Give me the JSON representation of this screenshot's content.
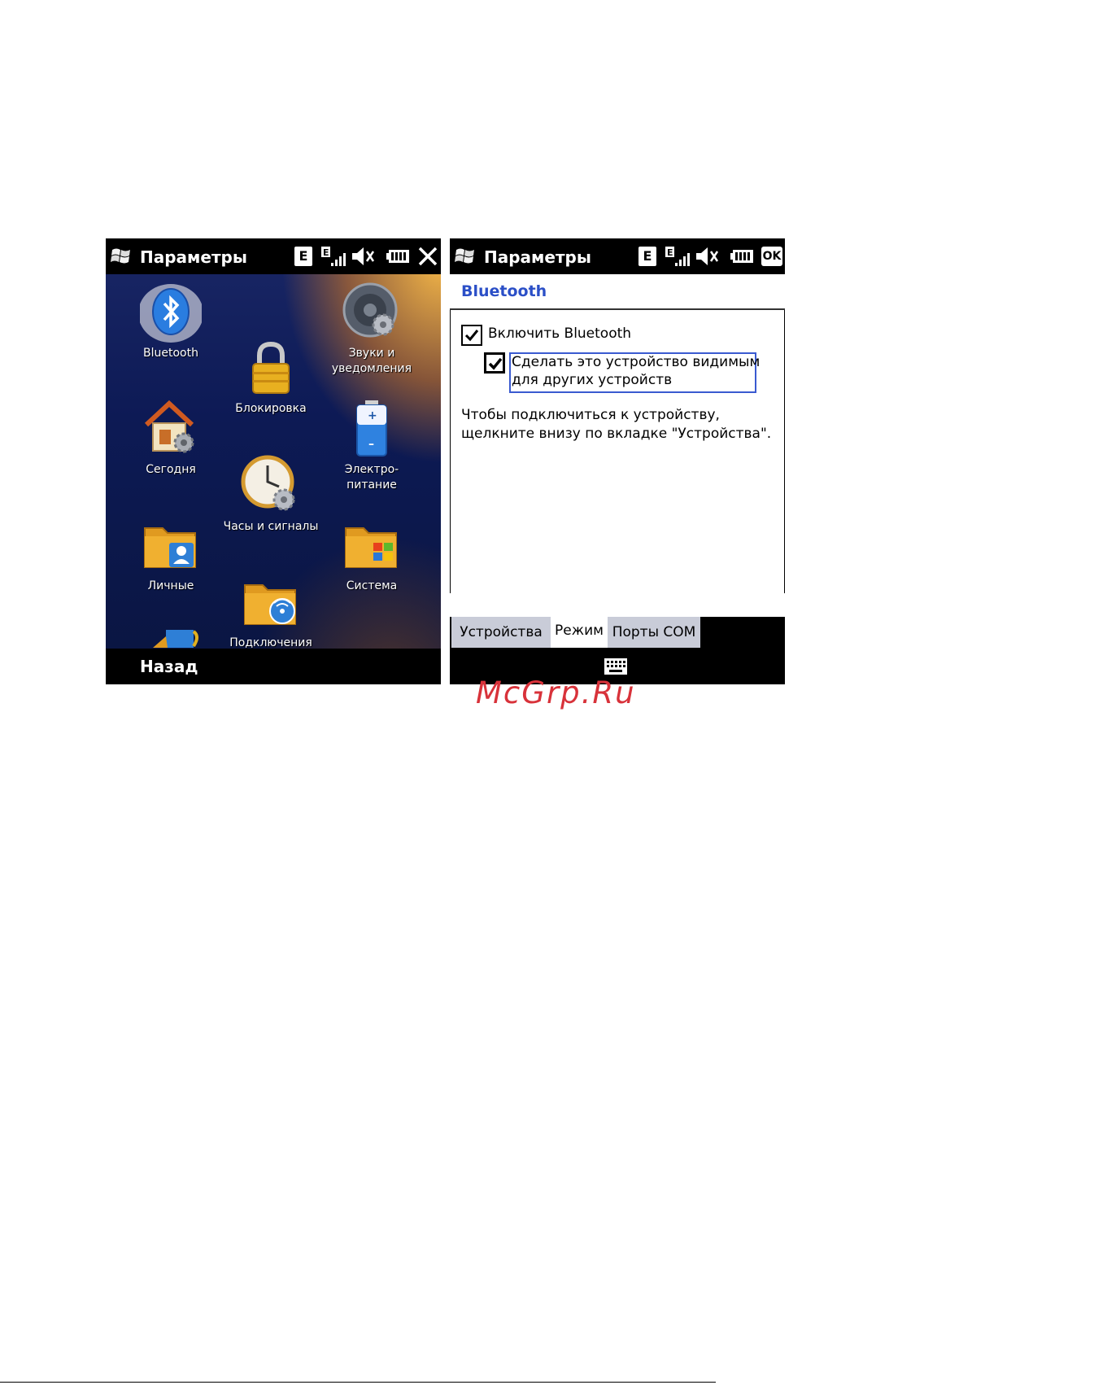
{
  "left_screen": {
    "title": "Параметры",
    "status_e": "E",
    "tiles": [
      {
        "label": "Bluetooth",
        "icon": "bluetooth-icon"
      },
      {
        "label": "Звуки и уведомления",
        "icon": "speaker-gear-icon"
      },
      {
        "label": "Блокировка",
        "icon": "padlock-icon"
      },
      {
        "label": "Сегодня",
        "icon": "house-gear-icon"
      },
      {
        "label": "Электро-",
        "label2": "питание",
        "icon": "battery-icon"
      },
      {
        "label": "Часы и сигналы",
        "icon": "clock-gear-icon"
      },
      {
        "label": "Личные",
        "icon": "folder-person-icon"
      },
      {
        "label": "Система",
        "icon": "folder-windows-icon"
      },
      {
        "label": "Подключения",
        "icon": "folder-wireless-icon"
      }
    ],
    "softkey_back": "Назад"
  },
  "right_screen": {
    "title": "Параметры",
    "status_e": "E",
    "ok_button": "OK",
    "header": "Bluetooth",
    "enable_checkbox": {
      "label": "Включить Bluetooth",
      "checked": true
    },
    "visible_checkbox": {
      "line1": "Сделать это устройство видимым",
      "line2": "для других устройств",
      "checked": true
    },
    "info_line1": "Чтобы подключиться к устройству,",
    "info_line2": "щелкните внизу по вкладке \"Устройства\".",
    "tabs": [
      {
        "label": "Устройства",
        "active": false
      },
      {
        "label": "Режим",
        "active": true
      },
      {
        "label": "Порты COM",
        "active": false
      }
    ]
  },
  "watermark": "McGrp.Ru",
  "colors": {
    "accent_blue": "#2b4fc7",
    "watermark_red": "#d8323a",
    "tab_inactive": "#c9ccd8"
  }
}
